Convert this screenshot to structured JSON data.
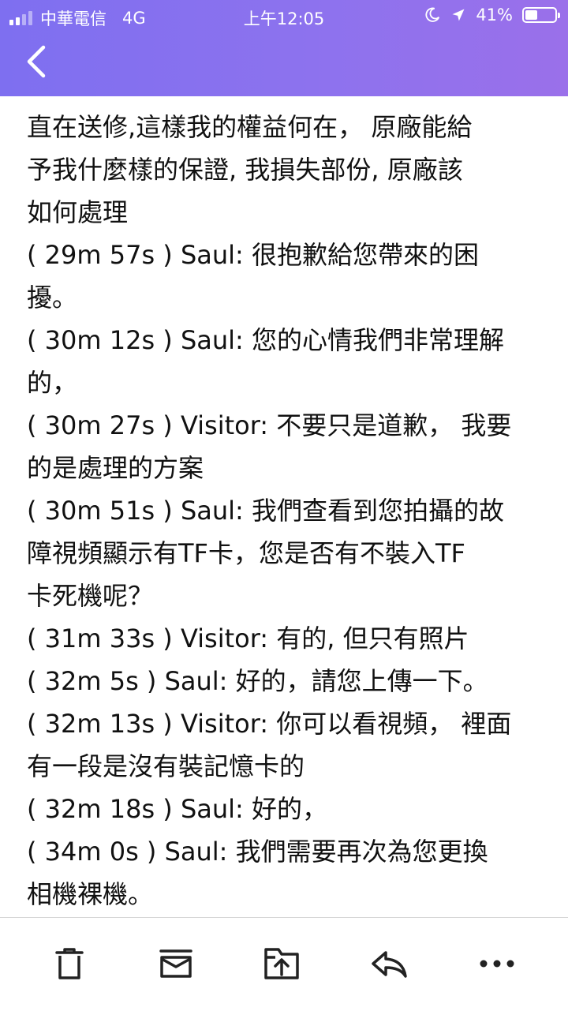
{
  "status_bar": {
    "carrier": "中華電信",
    "network": "4G",
    "time": "上午12:05",
    "battery_percent": "41%",
    "battery_level": 0.41
  },
  "header": {
    "background_color": "#8a72ee",
    "back_icon": "chevron-left-icon"
  },
  "message_lines": [
    "直在送修,這樣我的權益何在， 原廠能給",
    "予我什麼樣的保證, 我損失部份, 原廠該",
    "如何處理",
    "( 29m 57s ) Saul: 很抱歉給您帶來的困",
    "擾。",
    "( 30m 12s ) Saul: 您的心情我們非常理解",
    "的，",
    "( 30m 27s ) Visitor: 不要只是道歉， 我要",
    "的是處理的方案",
    "( 30m 51s ) Saul: 我們查看到您拍攝的故",
    "障視頻顯示有TF卡，您是否有不裝入TF",
    "卡死機呢？",
    "( 31m 33s ) Visitor: 有的, 但只有照片",
    "( 32m 5s ) Saul: 好的，請您上傳一下。",
    "( 32m 13s ) Visitor: 你可以看視頻， 裡面",
    "有一段是沒有裝記憶卡的",
    "( 32m 18s ) Saul: 好的，",
    "( 34m 0s ) Saul: 我們需要再次為您更換",
    "相機裸機。"
  ],
  "toolbar": {
    "buttons": [
      {
        "icon": "trash-icon"
      },
      {
        "icon": "archive-icon"
      },
      {
        "icon": "move-folder-icon"
      },
      {
        "icon": "reply-icon"
      },
      {
        "icon": "more-icon"
      }
    ]
  }
}
